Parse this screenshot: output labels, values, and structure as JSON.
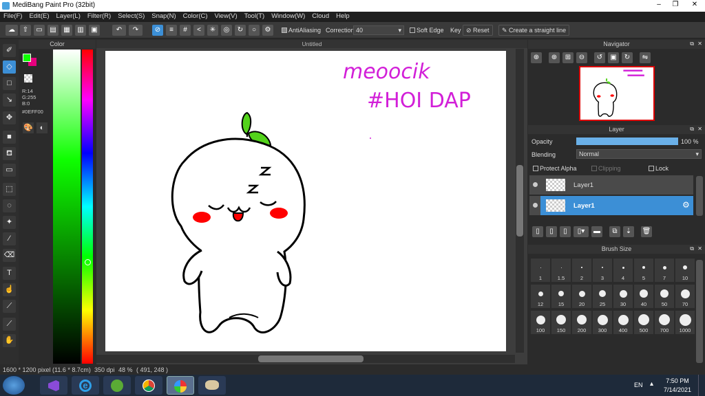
{
  "window": {
    "title": "MediBang Paint Pro (32bit)",
    "min": "–",
    "max": "❐",
    "close": "✕"
  },
  "menu": [
    "File(F)",
    "Edit(E)",
    "Layer(L)",
    "Filter(R)",
    "Select(S)",
    "Snap(N)",
    "Color(C)",
    "View(V)",
    "Tool(T)",
    "Window(W)",
    "Cloud",
    "Help"
  ],
  "toolbar": {
    "antialiasing_label": "AntiAliasing",
    "correction_label": "Correction",
    "correction_value": "40",
    "soft_edge_label": "Soft Edge",
    "key_label": "Key",
    "reset_label": "Reset",
    "straight_line_label": "Create a straight line"
  },
  "color_panel": {
    "title": "Color",
    "r": "R:14",
    "g": "G:255",
    "b": "B:0",
    "hex": "#0EFF00",
    "fg_color": "#0EFF00",
    "bg_color": "#E6007E"
  },
  "canvas": {
    "tab_title": "Untitled",
    "text_line1": "meoocik",
    "text_line2": "#HOI DAP",
    "text_color": "#D21FD8"
  },
  "navigator": {
    "title": "Navigator"
  },
  "layer_panel": {
    "title": "Layer",
    "opacity_label": "Opacity",
    "opacity_value": "100 %",
    "opacity_fraction": 1.0,
    "blending_label": "Blending",
    "blending_value": "Normal",
    "protect_alpha_label": "Protect Alpha",
    "clipping_label": "Clipping",
    "lock_label": "Lock",
    "layers": [
      {
        "name": "Layer1",
        "selected": false
      },
      {
        "name": "Layer1",
        "selected": true
      }
    ]
  },
  "brush_panel": {
    "title": "Brush Size",
    "sizes": [
      "1",
      "1.5",
      "2",
      "3",
      "4",
      "5",
      "7",
      "10",
      "12",
      "15",
      "20",
      "25",
      "30",
      "40",
      "50",
      "70",
      "100",
      "150",
      "200",
      "300",
      "400",
      "500",
      "700",
      "1000"
    ]
  },
  "status": {
    "pixels": "1600 * 1200 pixel",
    "cm": "(11.6 * 8.7cm)",
    "dpi": "350 dpi",
    "zoom": "48 %",
    "coords": "( 491, 248 )"
  },
  "taskbar": {
    "lang": "EN",
    "time": "7:50 PM",
    "date": "7/14/2021"
  }
}
